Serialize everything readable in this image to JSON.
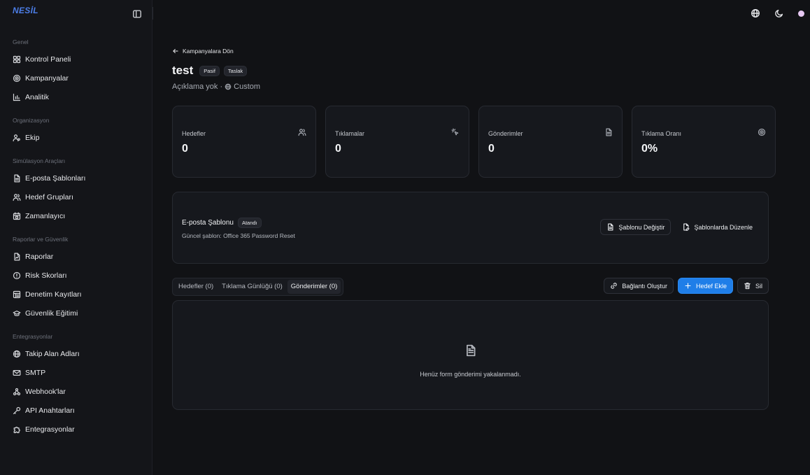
{
  "brand": "NESİL",
  "colors": {
    "background": "#111215",
    "sidebar": "#141519",
    "brand": "#4c7ee8",
    "primary_button": "#1f7ee8",
    "card": "#16181d",
    "avatar": "#e6c8f2"
  },
  "topbar": {
    "icons": [
      "sidebar-toggle-icon",
      "globe-icon",
      "moon-icon",
      "avatar"
    ]
  },
  "sidebar": {
    "sections": [
      {
        "heading": "Genel",
        "items": [
          {
            "label": "Kontrol Paneli",
            "icon": "grid-icon"
          },
          {
            "label": "Kampanyalar",
            "icon": "target-icon"
          },
          {
            "label": "Analitik",
            "icon": "bar-chart-icon"
          }
        ]
      },
      {
        "heading": "Organizasyon",
        "items": [
          {
            "label": "Ekip",
            "icon": "users-icon"
          }
        ]
      },
      {
        "heading": "Simülasyon Araçları",
        "items": [
          {
            "label": "E-posta Şablonları",
            "icon": "file-icon"
          },
          {
            "label": "Hedef Grupları",
            "icon": "user-group-icon"
          },
          {
            "label": "Zamanlayıcı",
            "icon": "calendar-icon"
          }
        ]
      },
      {
        "heading": "Raporlar ve Güvenlik",
        "items": [
          {
            "label": "Raporlar",
            "icon": "report-icon"
          },
          {
            "label": "Risk Skorları",
            "icon": "alert-circle-icon"
          },
          {
            "label": "Denetim Kayıtları",
            "icon": "audit-icon"
          },
          {
            "label": "Güvenlik Eğitimi",
            "icon": "graduation-cap-icon"
          }
        ]
      },
      {
        "heading": "Entegrasyonlar",
        "items": [
          {
            "label": "Takip Alan Adları",
            "icon": "globe-icon"
          },
          {
            "label": "SMTP",
            "icon": "mail-icon"
          },
          {
            "label": "Webhook'lar",
            "icon": "webhook-icon"
          },
          {
            "label": "API Anahtarları",
            "icon": "key-icon"
          },
          {
            "label": "Entegrasyonlar",
            "icon": "puzzle-icon"
          }
        ]
      }
    ]
  },
  "main": {
    "back_label": "Kampanyalara Dön",
    "title": "test",
    "badges": [
      "Pasif",
      "Taslak"
    ],
    "subtitle_text": "Açıklama yok ·",
    "subtitle_type": "Custom",
    "stats": [
      {
        "label": "Hedefler",
        "value": "0",
        "icon": "users-icon"
      },
      {
        "label": "Tıklamalar",
        "value": "0",
        "icon": "cursor-click-icon"
      },
      {
        "label": "Gönderimler",
        "value": "0",
        "icon": "file-icon"
      },
      {
        "label": "Tıklama Oranı",
        "value": "0%",
        "icon": "target-icon"
      }
    ],
    "template": {
      "title": "E-posta Şablonu",
      "badge": "Atandı",
      "current": "Güncel şablon: Office 365 Password Reset",
      "change_label": "Şablonu Değiştir",
      "edit_label": "Şablonlarda Düzenle"
    },
    "tabs": [
      {
        "label": "Hedefler (0)",
        "active": false
      },
      {
        "label": "Tıklama Günlüğü (0)",
        "active": false
      },
      {
        "label": "Gönderimler (0)",
        "active": true
      }
    ],
    "actions": {
      "link_label": "Bağlantı Oluştur",
      "add_label": "Hedef Ekle",
      "delete_label": "Sil"
    },
    "empty_text": "Henüz form gönderimi yakalanmadı."
  }
}
